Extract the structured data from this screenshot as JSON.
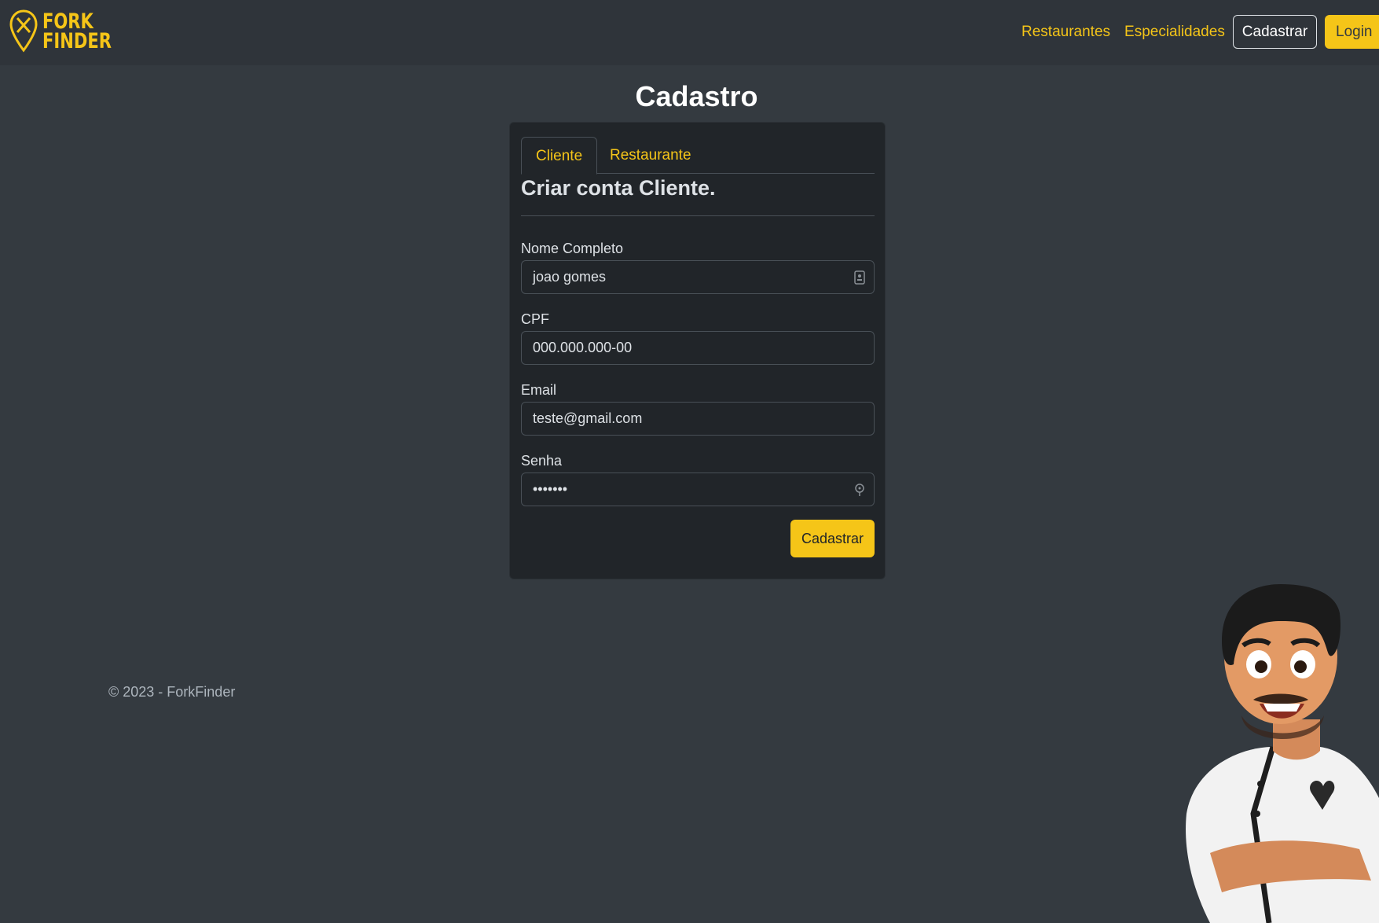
{
  "brand": {
    "line1": "FORK",
    "line2": "FINDER"
  },
  "nav": {
    "links": [
      "Restaurantes",
      "Especialidades"
    ],
    "register_label": "Cadastrar",
    "login_label": "Login"
  },
  "page": {
    "title": "Cadastro"
  },
  "form": {
    "tabs": [
      "Cliente",
      "Restaurante"
    ],
    "active_tab": "Cliente",
    "heading": "Criar conta Cliente.",
    "fields": [
      {
        "label": "Nome Completo",
        "value": "joao gomes"
      },
      {
        "label": "CPF",
        "value": "000.000.000-00"
      },
      {
        "label": "Email",
        "value": "teste@gmail.com"
      },
      {
        "label": "Senha",
        "value": "•••••••"
      }
    ],
    "submit_label": "Cadastrar"
  },
  "footer": {
    "text": "© 2023 - ForkFinder"
  },
  "colors": {
    "accent": "#f5c518",
    "background": "#343a40",
    "card": "#212529"
  }
}
